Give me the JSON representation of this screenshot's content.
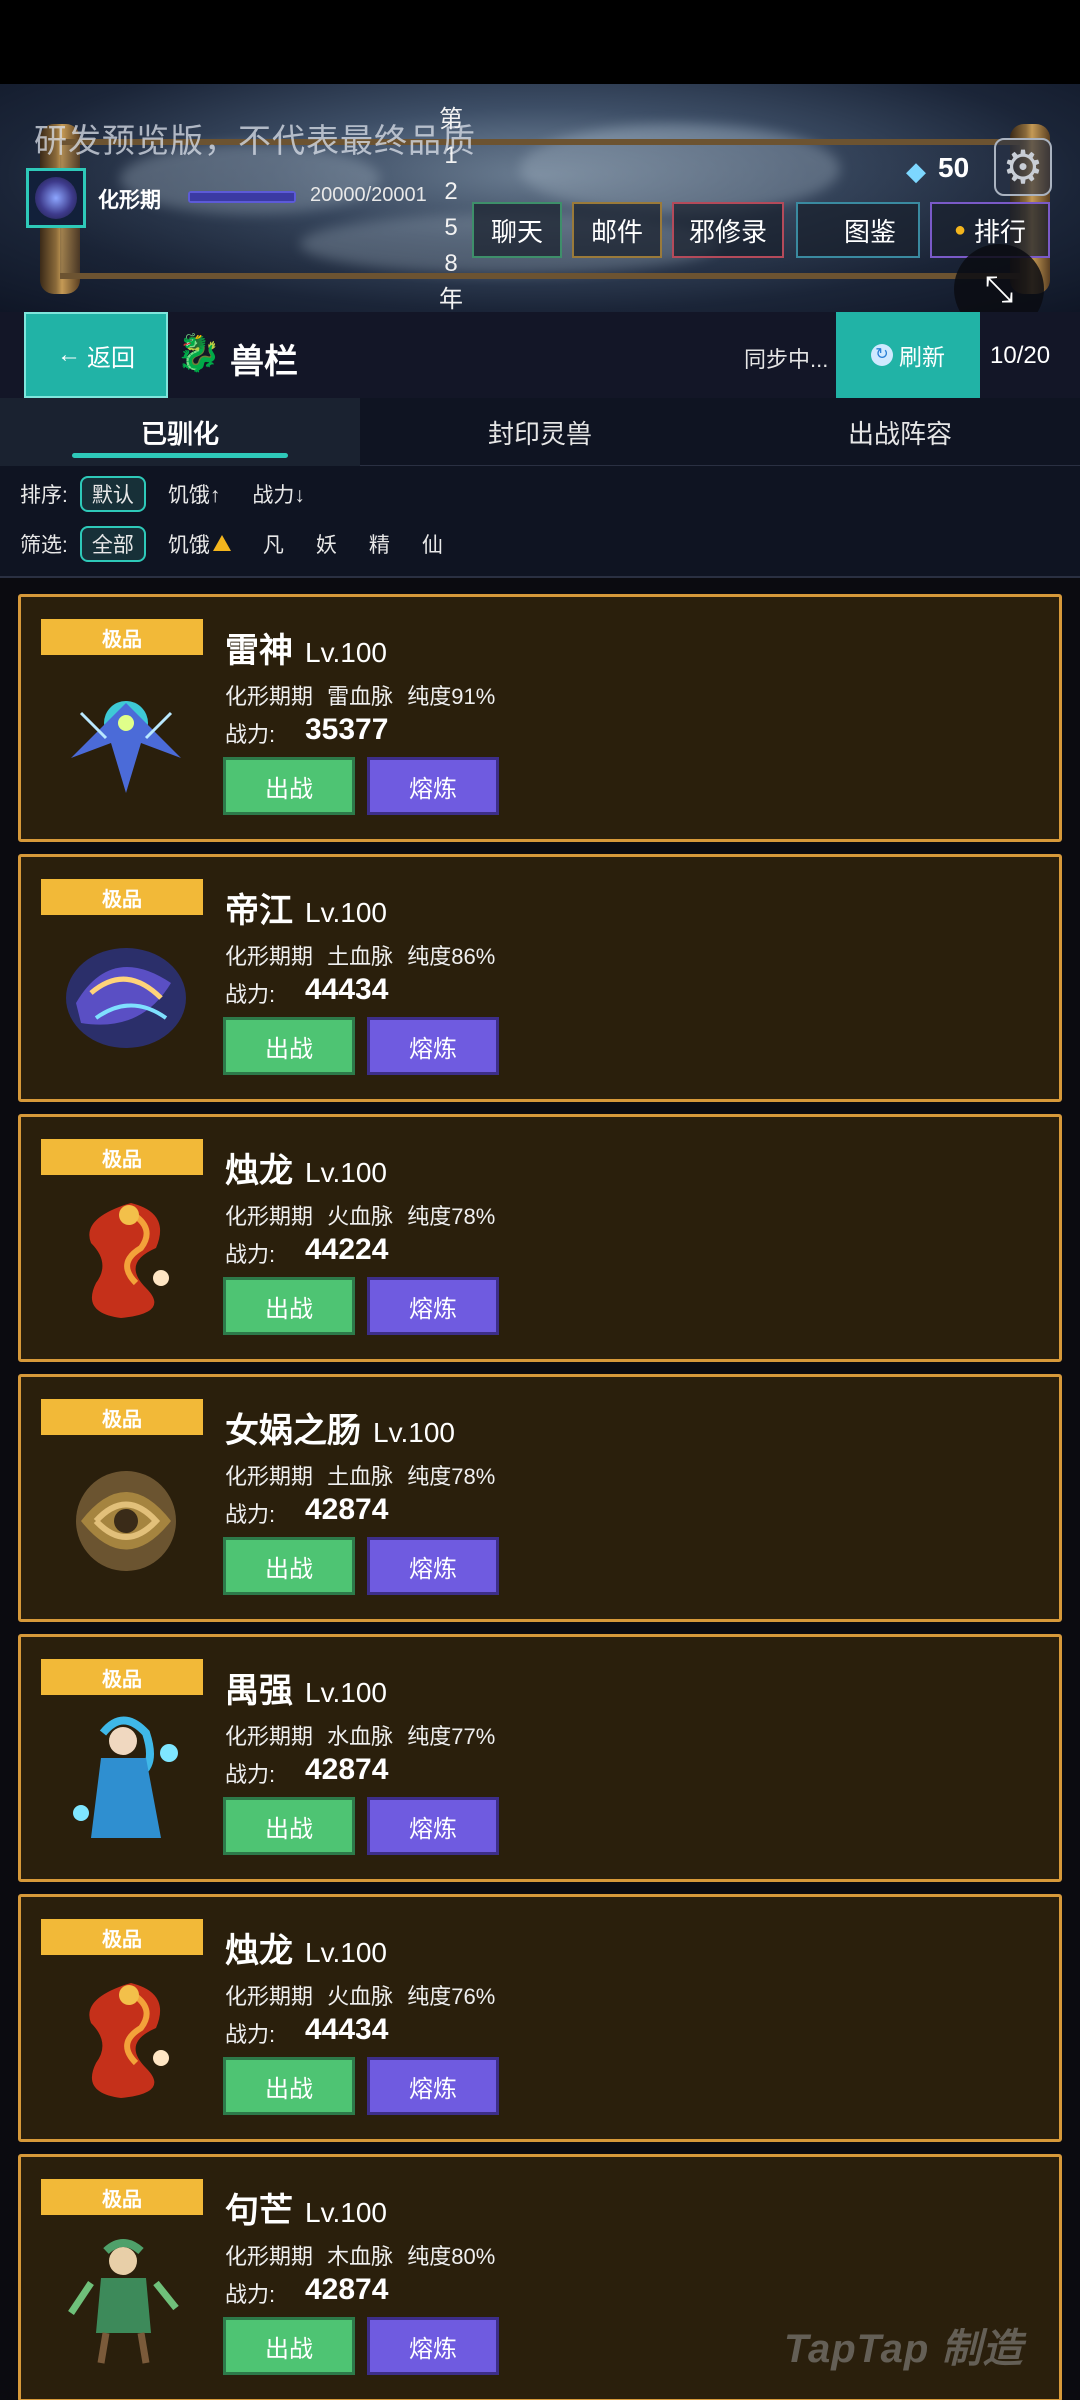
{
  "header": {
    "watermark": "研发预览版，不代表最终品质",
    "year_chars": [
      "第",
      "1",
      "2",
      "5",
      "8",
      "年"
    ],
    "realm": "化形期",
    "exp_progress": 0.99995,
    "exp_text": "20000/20001",
    "gems": "50",
    "buttons": {
      "chat": "聊天",
      "mail": "邮件",
      "evil": "邪修录",
      "atlas": "图鉴",
      "rank": "排行"
    },
    "colors": {
      "chat": "#3e8f6a",
      "mail": "#9a7a3a",
      "evil": "#b44a5a",
      "atlas": "#3a8aa0",
      "rank": "#7a5ac8"
    }
  },
  "nav": {
    "back": "返回",
    "title": "兽栏",
    "sync": "同步中...",
    "refresh": "刷新",
    "count": "10/20"
  },
  "tabs": [
    "已驯化",
    "封印灵兽",
    "出战阵容"
  ],
  "filters": {
    "sort_label": "排序:",
    "sort_options": [
      "默认",
      "饥饿↑",
      "战力↓"
    ],
    "filter_label": "筛选:",
    "filter_options": [
      "全部",
      "饥饿",
      "凡",
      "妖",
      "精",
      "仙"
    ]
  },
  "beasts": [
    {
      "tier": "极品",
      "name": "雷神",
      "level": "Lv.100",
      "info": "化形期期 雷血脉 纯度91%",
      "power_label": "战力:",
      "power": "35377",
      "fight": "出战",
      "smelt": "熔炼",
      "icon": "thunder-phoenix"
    },
    {
      "tier": "极品",
      "name": "帝江",
      "level": "Lv.100",
      "info": "化形期期 土血脉 纯度86%",
      "power_label": "战力:",
      "power": "44434",
      "fight": "出战",
      "smelt": "熔炼",
      "icon": "chaos-cloud"
    },
    {
      "tier": "极品",
      "name": "烛龙",
      "level": "Lv.100",
      "info": "化形期期 火血脉 纯度78%",
      "power_label": "战力:",
      "power": "44224",
      "fight": "出战",
      "smelt": "熔炼",
      "icon": "fire-dragon"
    },
    {
      "tier": "极品",
      "name": "女娲之肠",
      "level": "Lv.100",
      "info": "化形期期 土血脉 纯度78%",
      "power_label": "战力:",
      "power": "42874",
      "fight": "出战",
      "smelt": "熔炼",
      "icon": "earth-serpent"
    },
    {
      "tier": "极品",
      "name": "禺强",
      "level": "Lv.100",
      "info": "化形期期 水血脉 纯度77%",
      "power_label": "战力:",
      "power": "42874",
      "fight": "出战",
      "smelt": "熔炼",
      "icon": "water-god"
    },
    {
      "tier": "极品",
      "name": "烛龙",
      "level": "Lv.100",
      "info": "化形期期 火血脉 纯度76%",
      "power_label": "战力:",
      "power": "44434",
      "fight": "出战",
      "smelt": "熔炼",
      "icon": "fire-dragon"
    },
    {
      "tier": "极品",
      "name": "句芒",
      "level": "Lv.100",
      "info": "化形期期 木血脉 纯度80%",
      "power_label": "战力:",
      "power": "42874",
      "fight": "出战",
      "smelt": "熔炼",
      "icon": "wood-god"
    }
  ],
  "watermark_logo": "TapTap 制造"
}
